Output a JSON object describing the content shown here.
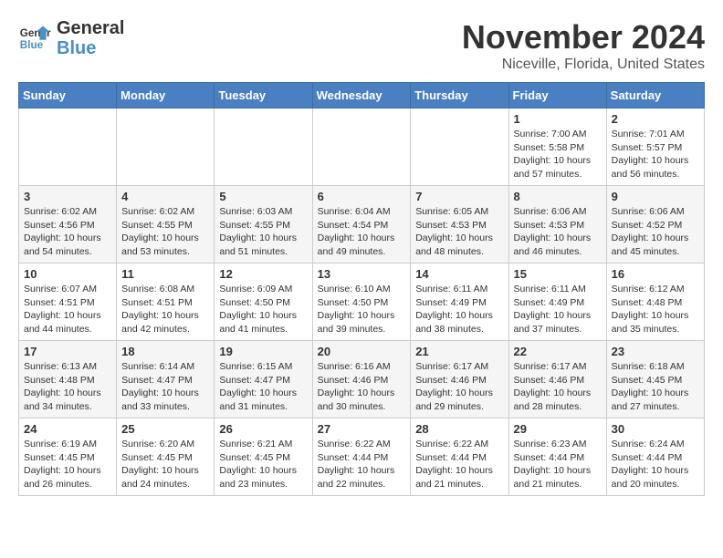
{
  "logo": {
    "line1": "General",
    "line2": "Blue"
  },
  "title": "November 2024",
  "location": "Niceville, Florida, United States",
  "days_of_week": [
    "Sunday",
    "Monday",
    "Tuesday",
    "Wednesday",
    "Thursday",
    "Friday",
    "Saturday"
  ],
  "weeks": [
    [
      {
        "day": "",
        "info": ""
      },
      {
        "day": "",
        "info": ""
      },
      {
        "day": "",
        "info": ""
      },
      {
        "day": "",
        "info": ""
      },
      {
        "day": "",
        "info": ""
      },
      {
        "day": "1",
        "info": "Sunrise: 7:00 AM\nSunset: 5:58 PM\nDaylight: 10 hours\nand 57 minutes."
      },
      {
        "day": "2",
        "info": "Sunrise: 7:01 AM\nSunset: 5:57 PM\nDaylight: 10 hours\nand 56 minutes."
      }
    ],
    [
      {
        "day": "3",
        "info": "Sunrise: 6:02 AM\nSunset: 4:56 PM\nDaylight: 10 hours\nand 54 minutes."
      },
      {
        "day": "4",
        "info": "Sunrise: 6:02 AM\nSunset: 4:55 PM\nDaylight: 10 hours\nand 53 minutes."
      },
      {
        "day": "5",
        "info": "Sunrise: 6:03 AM\nSunset: 4:55 PM\nDaylight: 10 hours\nand 51 minutes."
      },
      {
        "day": "6",
        "info": "Sunrise: 6:04 AM\nSunset: 4:54 PM\nDaylight: 10 hours\nand 49 minutes."
      },
      {
        "day": "7",
        "info": "Sunrise: 6:05 AM\nSunset: 4:53 PM\nDaylight: 10 hours\nand 48 minutes."
      },
      {
        "day": "8",
        "info": "Sunrise: 6:06 AM\nSunset: 4:53 PM\nDaylight: 10 hours\nand 46 minutes."
      },
      {
        "day": "9",
        "info": "Sunrise: 6:06 AM\nSunset: 4:52 PM\nDaylight: 10 hours\nand 45 minutes."
      }
    ],
    [
      {
        "day": "10",
        "info": "Sunrise: 6:07 AM\nSunset: 4:51 PM\nDaylight: 10 hours\nand 44 minutes."
      },
      {
        "day": "11",
        "info": "Sunrise: 6:08 AM\nSunset: 4:51 PM\nDaylight: 10 hours\nand 42 minutes."
      },
      {
        "day": "12",
        "info": "Sunrise: 6:09 AM\nSunset: 4:50 PM\nDaylight: 10 hours\nand 41 minutes."
      },
      {
        "day": "13",
        "info": "Sunrise: 6:10 AM\nSunset: 4:50 PM\nDaylight: 10 hours\nand 39 minutes."
      },
      {
        "day": "14",
        "info": "Sunrise: 6:11 AM\nSunset: 4:49 PM\nDaylight: 10 hours\nand 38 minutes."
      },
      {
        "day": "15",
        "info": "Sunrise: 6:11 AM\nSunset: 4:49 PM\nDaylight: 10 hours\nand 37 minutes."
      },
      {
        "day": "16",
        "info": "Sunrise: 6:12 AM\nSunset: 4:48 PM\nDaylight: 10 hours\nand 35 minutes."
      }
    ],
    [
      {
        "day": "17",
        "info": "Sunrise: 6:13 AM\nSunset: 4:48 PM\nDaylight: 10 hours\nand 34 minutes."
      },
      {
        "day": "18",
        "info": "Sunrise: 6:14 AM\nSunset: 4:47 PM\nDaylight: 10 hours\nand 33 minutes."
      },
      {
        "day": "19",
        "info": "Sunrise: 6:15 AM\nSunset: 4:47 PM\nDaylight: 10 hours\nand 31 minutes."
      },
      {
        "day": "20",
        "info": "Sunrise: 6:16 AM\nSunset: 4:46 PM\nDaylight: 10 hours\nand 30 minutes."
      },
      {
        "day": "21",
        "info": "Sunrise: 6:17 AM\nSunset: 4:46 PM\nDaylight: 10 hours\nand 29 minutes."
      },
      {
        "day": "22",
        "info": "Sunrise: 6:17 AM\nSunset: 4:46 PM\nDaylight: 10 hours\nand 28 minutes."
      },
      {
        "day": "23",
        "info": "Sunrise: 6:18 AM\nSunset: 4:45 PM\nDaylight: 10 hours\nand 27 minutes."
      }
    ],
    [
      {
        "day": "24",
        "info": "Sunrise: 6:19 AM\nSunset: 4:45 PM\nDaylight: 10 hours\nand 26 minutes."
      },
      {
        "day": "25",
        "info": "Sunrise: 6:20 AM\nSunset: 4:45 PM\nDaylight: 10 hours\nand 24 minutes."
      },
      {
        "day": "26",
        "info": "Sunrise: 6:21 AM\nSunset: 4:45 PM\nDaylight: 10 hours\nand 23 minutes."
      },
      {
        "day": "27",
        "info": "Sunrise: 6:22 AM\nSunset: 4:44 PM\nDaylight: 10 hours\nand 22 minutes."
      },
      {
        "day": "28",
        "info": "Sunrise: 6:22 AM\nSunset: 4:44 PM\nDaylight: 10 hours\nand 21 minutes."
      },
      {
        "day": "29",
        "info": "Sunrise: 6:23 AM\nSunset: 4:44 PM\nDaylight: 10 hours\nand 21 minutes."
      },
      {
        "day": "30",
        "info": "Sunrise: 6:24 AM\nSunset: 4:44 PM\nDaylight: 10 hours\nand 20 minutes."
      }
    ]
  ]
}
